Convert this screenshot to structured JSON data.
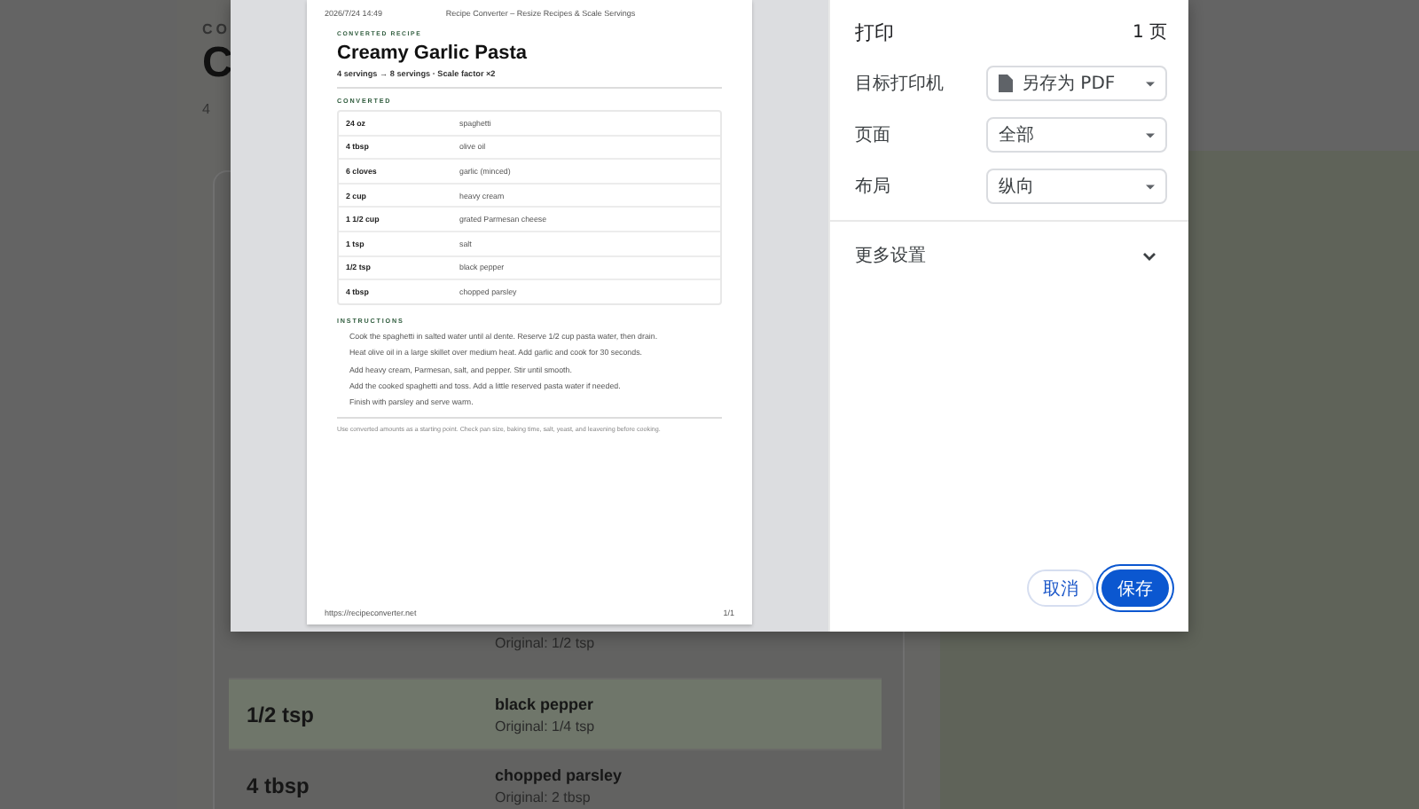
{
  "background_page": {
    "eyebrow": "CO",
    "title": "C",
    "subtitle": "4",
    "rows": [
      {
        "amount": "",
        "name": "",
        "original": "Original: 1/2 tsp",
        "selected": false
      },
      {
        "amount": "1/2 tsp",
        "name": "black pepper",
        "original": "Original: 1/4 tsp",
        "selected": true
      },
      {
        "amount": "4 tbsp",
        "name": "chopped parsley",
        "original": "Original: 2 tbsp",
        "selected": false
      }
    ]
  },
  "print_preview": {
    "header_left": "2026/7/24 14:49",
    "header_center": "Recipe Converter – Resize Recipes & Scale Servings",
    "eyebrow": "CONVERTED RECIPE",
    "title": "Creamy Garlic Pasta",
    "subtitle": "4 servings → 8 servings · Scale factor ×2",
    "table_heading": "CONVERTED",
    "ingredients": [
      {
        "amount": "24 oz",
        "name": "spaghetti"
      },
      {
        "amount": "4 tbsp",
        "name": "olive oil"
      },
      {
        "amount": "6 cloves",
        "name": "garlic (minced)"
      },
      {
        "amount": "2 cup",
        "name": "heavy cream"
      },
      {
        "amount": "1 1/2 cup",
        "name": "grated Parmesan cheese"
      },
      {
        "amount": "1 tsp",
        "name": "salt"
      },
      {
        "amount": "1/2 tsp",
        "name": "black pepper"
      },
      {
        "amount": "4 tbsp",
        "name": "chopped parsley"
      }
    ],
    "instructions_heading": "INSTRUCTIONS",
    "instructions": [
      "Cook the spaghetti in salted water until al dente. Reserve 1/2 cup pasta water, then drain.",
      "Heat olive oil in a large skillet over medium heat. Add garlic and cook for 30 seconds.",
      "Add heavy cream, Parmesan, salt, and pepper. Stir until smooth.",
      "Add the cooked spaghetti and toss. Add a little reserved pasta water if needed.",
      "Finish with parsley and serve warm."
    ],
    "note": "Use converted amounts as a starting point. Check pan size, baking time, salt, yeast, and leavening before cooking.",
    "footer_left": "https://recipeconverter.net",
    "footer_right": "1/1"
  },
  "print_settings": {
    "title": "打印",
    "page_count": "1 页",
    "fields": [
      {
        "label": "目标打印机",
        "value": "另存为 PDF",
        "kind": "printer"
      },
      {
        "label": "页面",
        "value": "全部",
        "kind": "plain"
      },
      {
        "label": "布局",
        "value": "纵向",
        "kind": "plain"
      }
    ],
    "more_settings": {
      "label": "更多设置",
      "expanded": false
    },
    "buttons": [
      {
        "label": "取消",
        "kind": "secondary"
      },
      {
        "label": "保存",
        "kind": "primary"
      }
    ]
  }
}
